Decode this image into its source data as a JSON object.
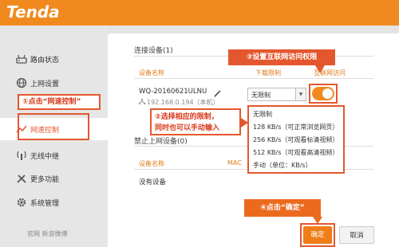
{
  "header": {
    "logo": "Tenda"
  },
  "sidebar": {
    "items": [
      {
        "label": "路由状态",
        "icon": "router-icon"
      },
      {
        "label": "上网设置",
        "icon": "globe-icon"
      },
      {
        "label": "网速控制",
        "icon": "speed-chart-icon",
        "active": true
      },
      {
        "label": "无线中继",
        "icon": "wireless-icon"
      },
      {
        "label": "更多功能",
        "icon": "tools-icon"
      },
      {
        "label": "系统管理",
        "icon": "gear-icon"
      }
    ],
    "footer": "官网   新浪微博"
  },
  "connected": {
    "title": "连接设备(1)",
    "columns": [
      "设备名称",
      "下载限制",
      "互联网访问"
    ],
    "device": {
      "name": "WQ-20160621ULNU",
      "ip": "192.168.0.194（本机）",
      "limit": "无限制",
      "internet_access": true
    }
  },
  "dropdown": {
    "options": [
      "无限制",
      "128 KB/s（可正常浏览网页）",
      "256 KB/s（可观看标清视频）",
      "512 KB/s（可观看高清视频）",
      "手动（单位：KB/s）"
    ]
  },
  "blocked": {
    "title": "禁止上网设备(0)",
    "columns": [
      "设备名称",
      "MAC"
    ],
    "empty": "没有设备"
  },
  "buttons": {
    "ok": "确定",
    "cancel": "取消"
  },
  "callouts": {
    "step1": "①点击“网速控制”",
    "step2_line1": "②选择相应的限制，",
    "step2_line2": "同时也可以手动输入",
    "step3": "③设置互联网访问权限",
    "step4": "④点击“确定”"
  },
  "colors": {
    "brand": "#f08a1e",
    "callout": "#e4572e",
    "header_text": "#e07b1a"
  }
}
